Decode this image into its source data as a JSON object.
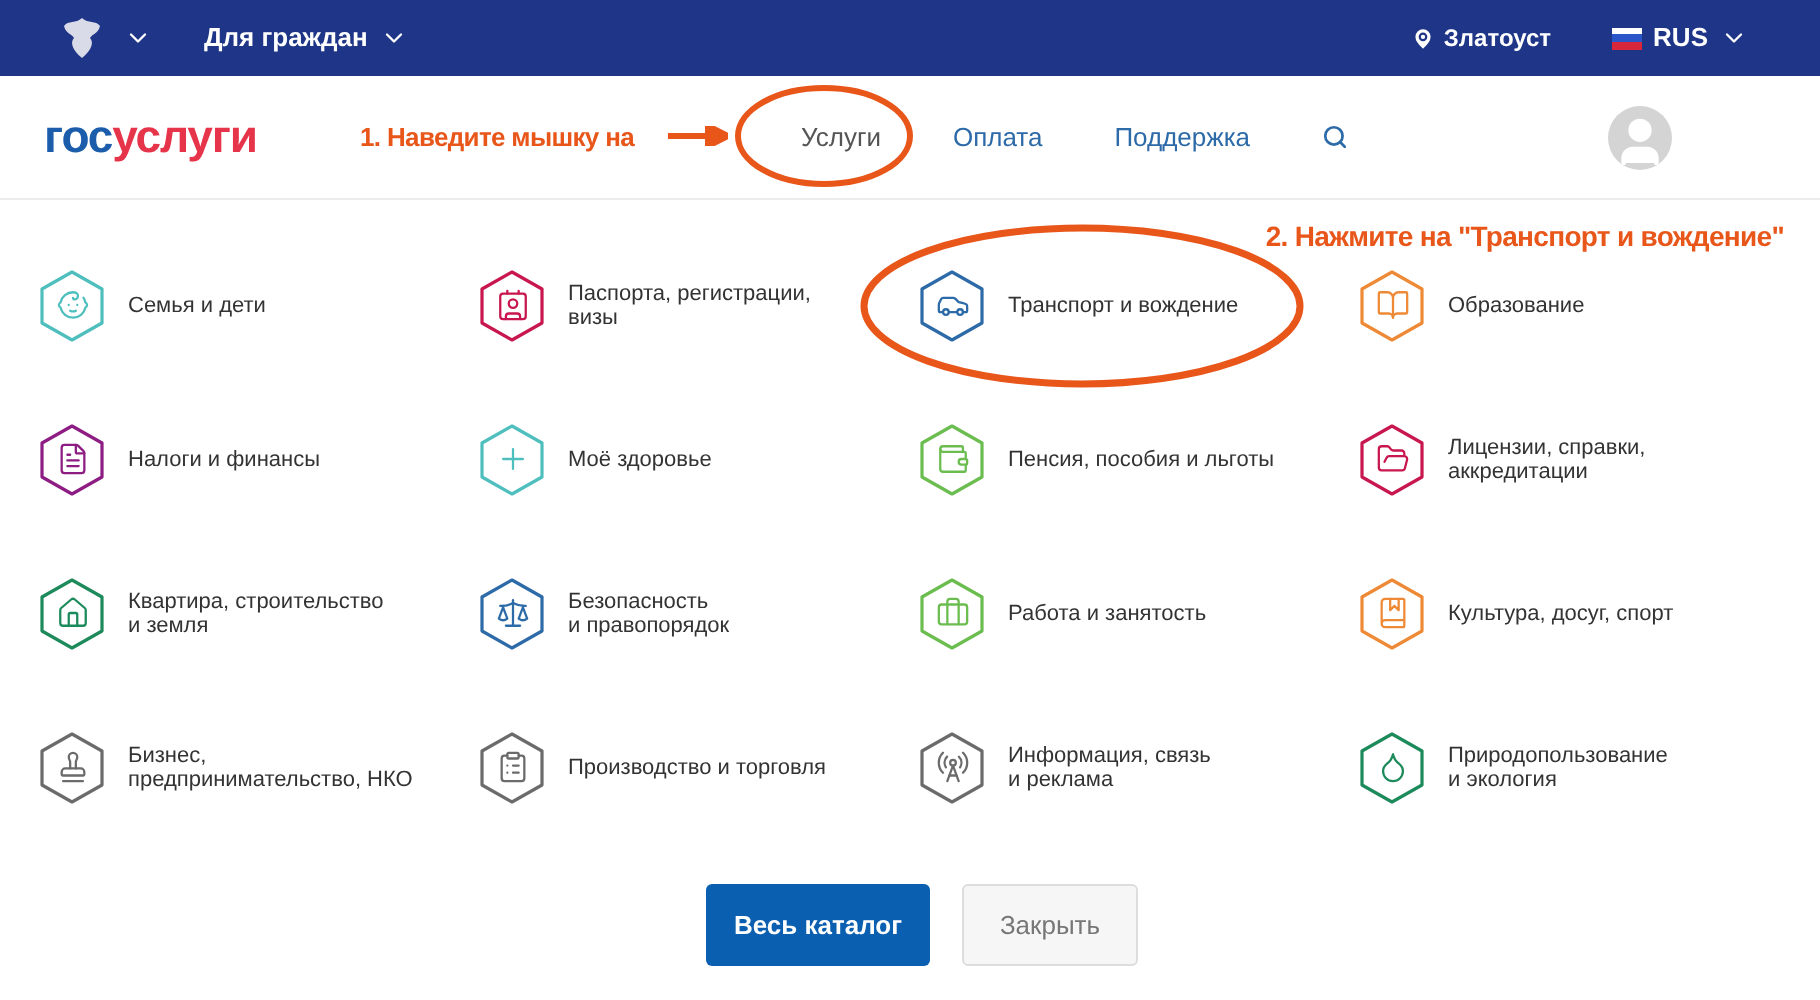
{
  "top_bar": {
    "menu_label": "Для граждан",
    "city": "Златоуст",
    "language": "RUS"
  },
  "header": {
    "logo": [
      {
        "text": "гос",
        "color": "#1b5dab"
      },
      {
        "text": "услуги",
        "color": "#e6344a"
      }
    ],
    "nav": [
      {
        "label": "Услуги",
        "selected": true
      },
      {
        "label": "Оплата",
        "selected": false
      },
      {
        "label": "Поддержка",
        "selected": false
      }
    ]
  },
  "annotations": {
    "step_1": "1. Наведите мышку на",
    "step_2": "2. Нажмите на \"Транспорт и вождение\""
  },
  "categories": [
    {
      "label": "Семья и дети",
      "kind": "family",
      "color": "#4fbfbd"
    },
    {
      "label": "Паспорта, регистрации,\nвизы",
      "kind": "passport",
      "color": "#c8174e"
    },
    {
      "label": "Транспорт и вождение",
      "kind": "transport",
      "color": "#2d6aa8"
    },
    {
      "label": "Образование",
      "kind": "education",
      "color": "#ee8a36"
    },
    {
      "label": "Налоги и финансы",
      "kind": "taxes",
      "color": "#8d1d83"
    },
    {
      "label": "Моё здоровье",
      "kind": "health",
      "color": "#4fbfbd"
    },
    {
      "label": "Пенсия, пособия и льготы",
      "kind": "pension",
      "color": "#6bbd4f"
    },
    {
      "label": "Лицензии, справки,\nаккредитации",
      "kind": "licenses",
      "color": "#c8174e"
    },
    {
      "label": "Квартира, строительство\nи земля",
      "kind": "housing",
      "color": "#1d8a5c"
    },
    {
      "label": "Безопасность\nи правопорядок",
      "kind": "security",
      "color": "#2d6aa8"
    },
    {
      "label": "Работа и занятость",
      "kind": "work",
      "color": "#6bbd4f"
    },
    {
      "label": "Культура, досуг, спорт",
      "kind": "culture",
      "color": "#ee8a36"
    },
    {
      "label": "Бизнес,\nпредпринимательство, НКО",
      "kind": "business",
      "color": "#6b6b6b"
    },
    {
      "label": "Производство и торговля",
      "kind": "production",
      "color": "#6b6b6b"
    },
    {
      "label": "Информация, связь\nи реклама",
      "kind": "information",
      "color": "#6b6b6b"
    },
    {
      "label": "Природопользование\nи экология",
      "kind": "ecology",
      "color": "#1d8a5c"
    }
  ],
  "buttons": [
    {
      "label": "Весь каталог",
      "kind": "primary"
    },
    {
      "label": "Закрыть",
      "kind": "secondary"
    }
  ]
}
